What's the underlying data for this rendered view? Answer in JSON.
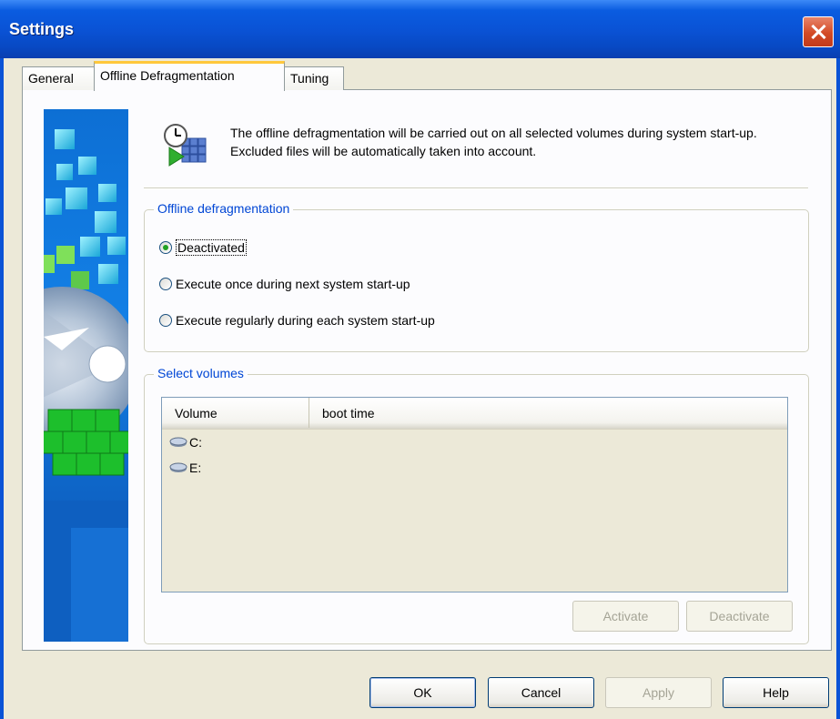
{
  "window": {
    "title": "Settings"
  },
  "tabs": [
    {
      "label": "General",
      "active": false
    },
    {
      "label": "Offline Defragmentation",
      "active": true
    },
    {
      "label": "Tuning",
      "active": false
    }
  ],
  "info": {
    "icon": "schedule-defrag-icon",
    "text": "The offline defragmentation will be carried out on all selected volumes during system start-up. Excluded files will be automatically taken into account."
  },
  "offline_group": {
    "title": "Offline defragmentation",
    "options": [
      {
        "label": "Deactivated",
        "checked": true
      },
      {
        "label": "Execute once during next system start-up",
        "checked": false
      },
      {
        "label": "Execute regularly during each system start-up",
        "checked": false
      }
    ]
  },
  "volumes_group": {
    "title": "Select volumes",
    "columns": [
      "Volume",
      "boot time"
    ],
    "rows": [
      {
        "volume": "C:",
        "boot_time": ""
      },
      {
        "volume": "E:",
        "boot_time": ""
      }
    ],
    "activate_label": "Activate",
    "deactivate_label": "Deactivate"
  },
  "footer": {
    "ok_label": "OK",
    "cancel_label": "Cancel",
    "apply_label": "Apply",
    "help_label": "Help"
  },
  "colors": {
    "title_bar": "#0a53d6",
    "group_title": "#0046d5",
    "dialog_bg": "#ece9d8",
    "radio_dot": "#21a121"
  }
}
